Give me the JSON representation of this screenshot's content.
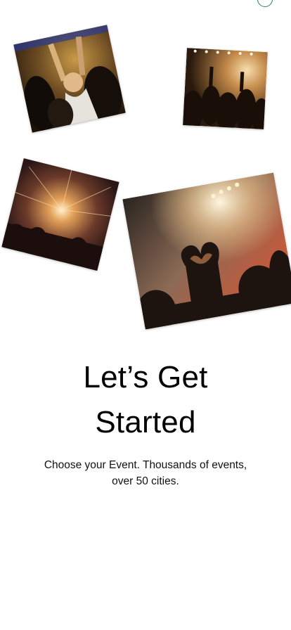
{
  "onboarding": {
    "title_line1": "Let’s Get",
    "title_line2": "Started",
    "subtitle_line1": "Choose your Event. Thousands of events,",
    "subtitle_line2": "over 50 cities."
  },
  "colors": {
    "background": "#ffffff",
    "title": "#000000",
    "accent_circle": "#2f7a6a"
  }
}
